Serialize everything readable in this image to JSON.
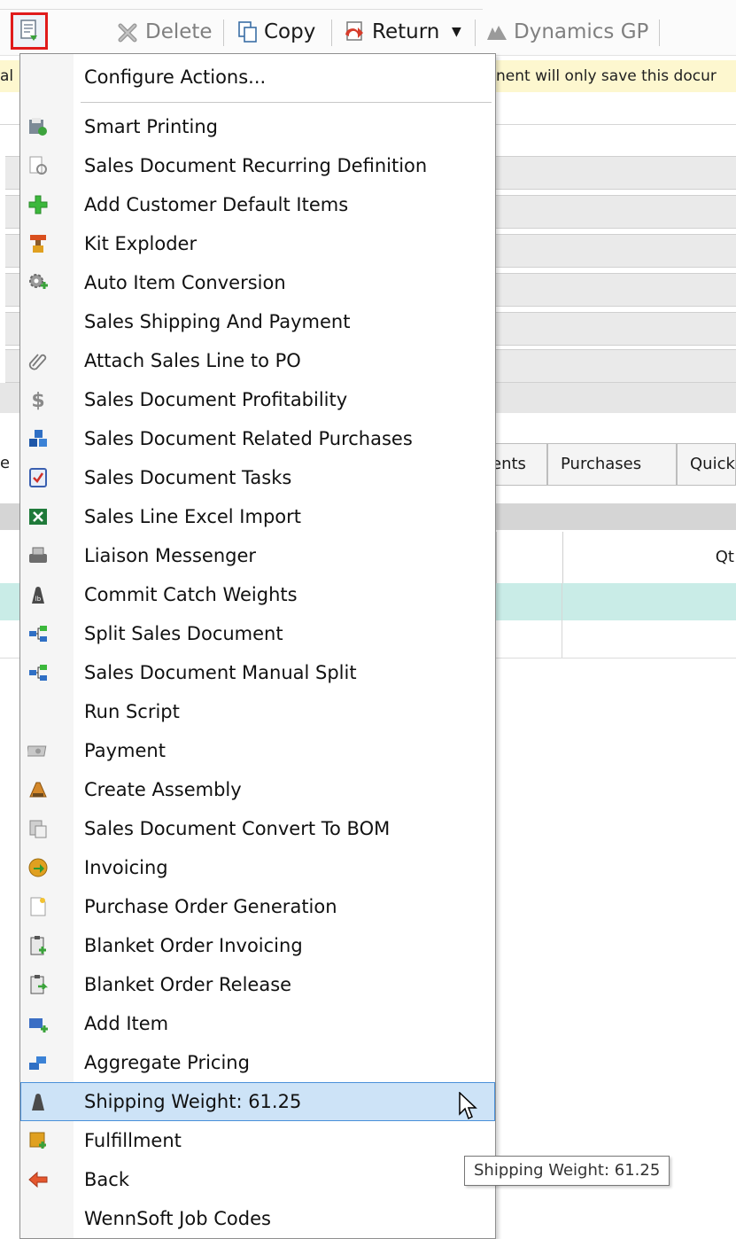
{
  "toolbar": {
    "delete_label": "Delete",
    "copy_label": "Copy",
    "return_label": "Return",
    "gp_label": "Dynamics GP"
  },
  "background": {
    "info_left": "al",
    "info_right": "nent will only save this docur",
    "tabs": [
      "es",
      "ents",
      "Purchases",
      "Quick"
    ],
    "grid_col": "Qt"
  },
  "menu": {
    "header": "Configure Actions...",
    "items": [
      {
        "label": "Smart Printing",
        "icon": "smart-printing-icon"
      },
      {
        "label": "Sales Document Recurring Definition",
        "icon": "recurring-definition-icon"
      },
      {
        "label": "Add Customer Default Items",
        "icon": "green-plus-icon"
      },
      {
        "label": "Kit Exploder",
        "icon": "kit-exploder-icon"
      },
      {
        "label": "Auto Item Conversion",
        "icon": "gear-plus-icon"
      },
      {
        "label": "Sales Shipping And Payment",
        "icon": ""
      },
      {
        "label": "Attach Sales Line to PO",
        "icon": "paperclip-icon"
      },
      {
        "label": "Sales Document Profitability",
        "icon": "dollar-icon"
      },
      {
        "label": "Sales Document Related Purchases",
        "icon": "blue-cubes-icon"
      },
      {
        "label": "Sales Document Tasks",
        "icon": "tasks-checklist-icon"
      },
      {
        "label": "Sales Line Excel Import",
        "icon": "excel-icon"
      },
      {
        "label": "Liaison Messenger",
        "icon": "messenger-icon"
      },
      {
        "label": "Commit Catch Weights",
        "icon": "weight-icon"
      },
      {
        "label": "Split Sales Document",
        "icon": "split-icon"
      },
      {
        "label": "Sales Document Manual Split",
        "icon": "split-icon"
      },
      {
        "label": "Run Script",
        "icon": ""
      },
      {
        "label": "Payment",
        "icon": "money-icon"
      },
      {
        "label": "Create Assembly",
        "icon": "assembly-icon"
      },
      {
        "label": "Sales Document Convert To BOM",
        "icon": "bom-icon"
      },
      {
        "label": "Invoicing",
        "icon": "invoicing-icon"
      },
      {
        "label": "Purchase Order Generation",
        "icon": "new-document-icon"
      },
      {
        "label": "Blanket Order Invoicing",
        "icon": "clipboard-plus-icon"
      },
      {
        "label": "Blanket Order Release",
        "icon": "clipboard-arrow-icon"
      },
      {
        "label": "Add Item",
        "icon": "add-item-icon"
      },
      {
        "label": "Aggregate Pricing",
        "icon": "aggregate-icon"
      },
      {
        "label": "Shipping Weight: 61.25",
        "icon": "weight-icon"
      },
      {
        "label": "Fulfillment",
        "icon": "fulfillment-icon"
      },
      {
        "label": "Back",
        "icon": "back-arrow-icon"
      },
      {
        "label": "WennSoft Job Codes",
        "icon": ""
      }
    ]
  },
  "tooltip": "Shipping Weight: 61.25",
  "colors": {
    "trigger_border": "#e01b1b",
    "highlight_bg": "#cde3f7",
    "highlight_border": "#4a90d9",
    "info_bar": "#fdf7cf",
    "selected_row": "#c9ece7"
  }
}
